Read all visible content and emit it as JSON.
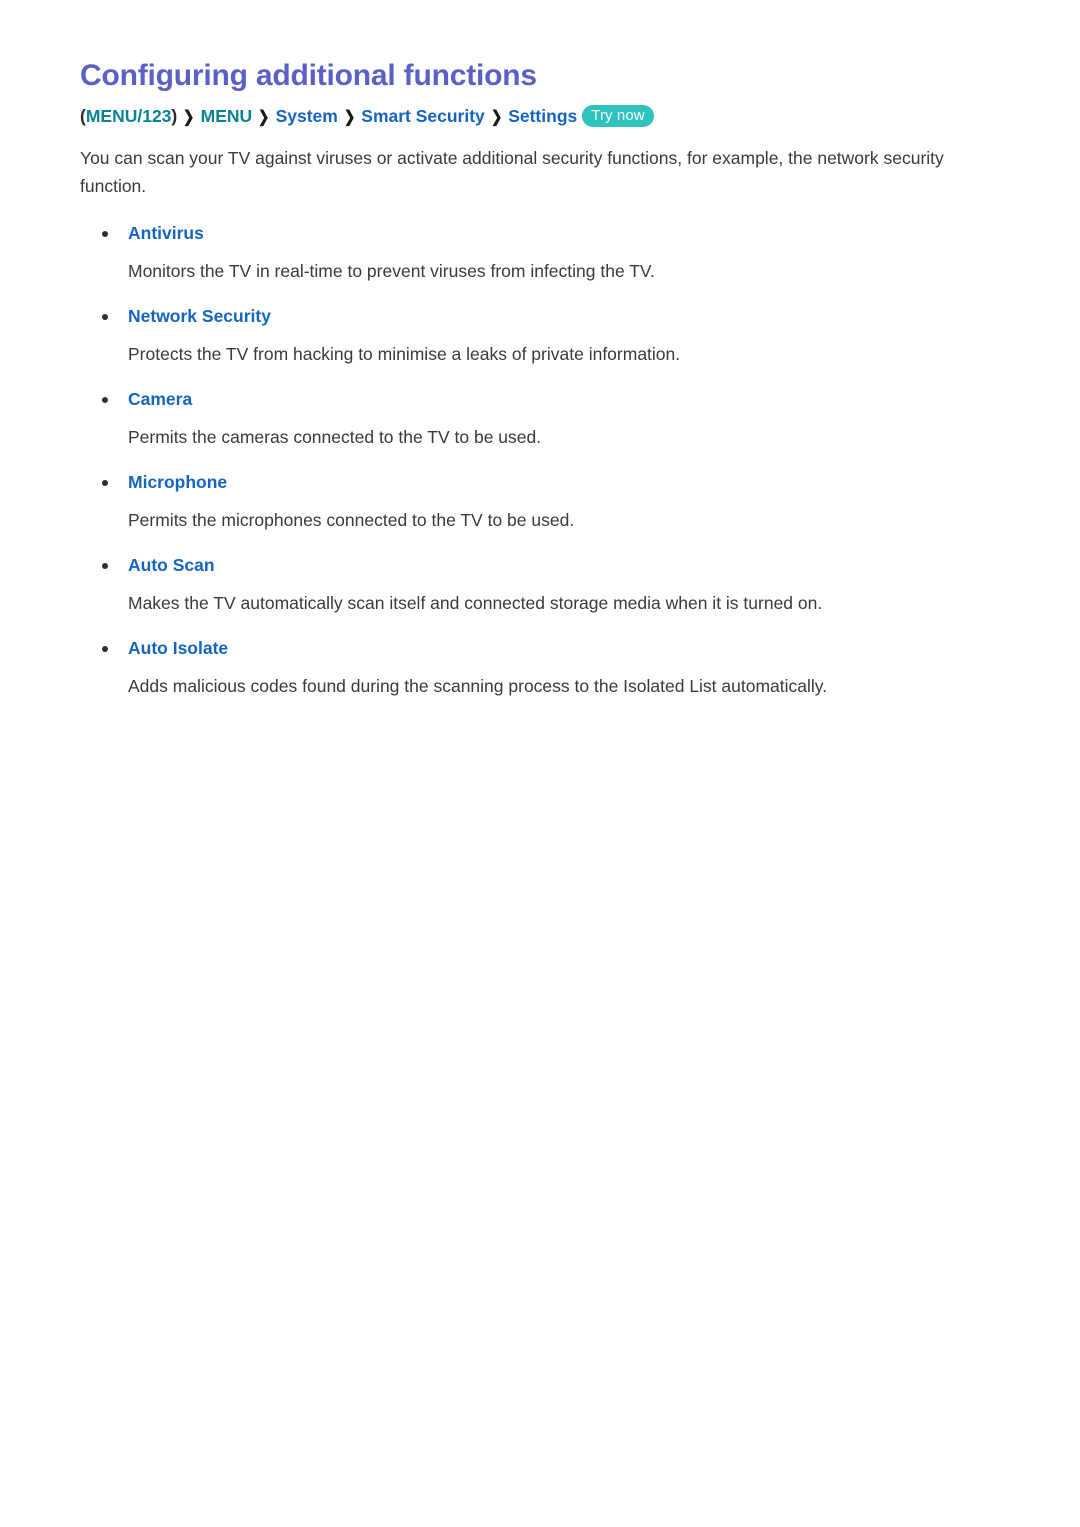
{
  "page": {
    "title": "Configuring additional functions",
    "intro": "You can scan your TV against viruses or activate additional security functions, for example, the network security function."
  },
  "breadcrumb": {
    "open_paren": "(",
    "close_paren": ")",
    "item1": "MENU/123",
    "sep": "❯",
    "item2": "MENU",
    "item3": "System",
    "item4": "Smart Security",
    "item5": "Settings",
    "badge": "Try now"
  },
  "features": [
    {
      "label": "Antivirus",
      "description": "Monitors the TV in real-time to prevent viruses from infecting the TV."
    },
    {
      "label": "Network Security",
      "description": "Protects the TV from hacking to minimise a leaks of private information."
    },
    {
      "label": "Camera",
      "description": "Permits the cameras connected to the TV to be used."
    },
    {
      "label": "Microphone",
      "description": "Permits the microphones connected to the TV to be used."
    },
    {
      "label": "Auto Scan",
      "description": "Makes the TV automatically scan itself and connected storage media when it is turned on."
    },
    {
      "label": "Auto Isolate",
      "description": "Adds malicious codes found during the scanning process to the Isolated List automatically."
    }
  ],
  "colors": {
    "title": "#5b5fc7",
    "breadcrumb_teal": "#0a8296",
    "breadcrumb_blue": "#1565c0",
    "badge_bg": "#2ec4bd",
    "body_text": "#3a3a3a"
  }
}
